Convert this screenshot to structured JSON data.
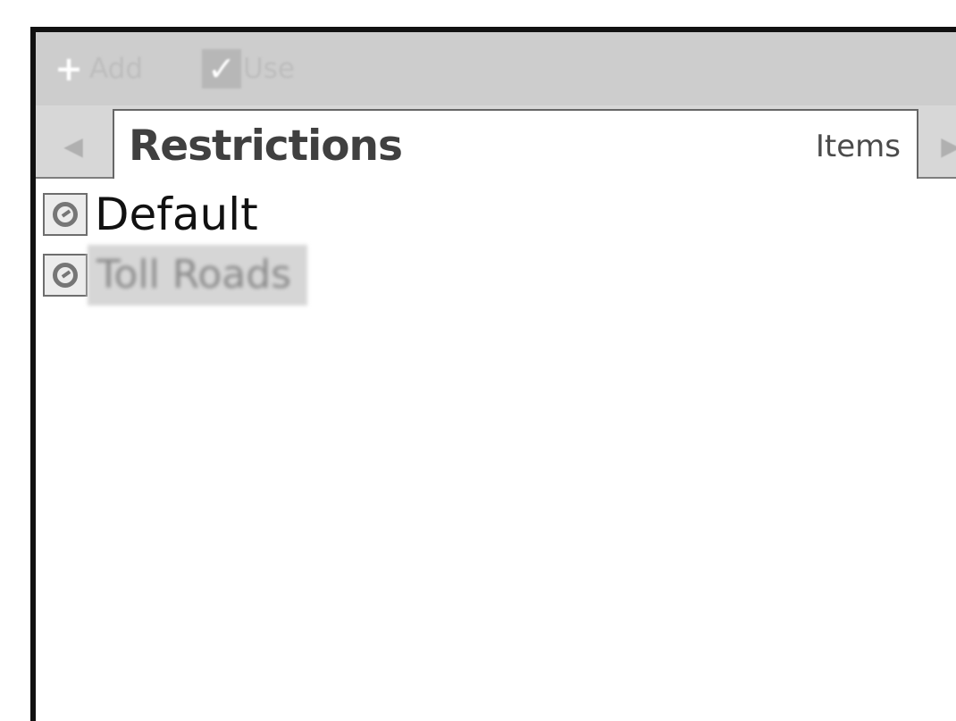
{
  "toolbar": {
    "add_icon": "+",
    "add_label": "Add",
    "use_icon": "✓",
    "use_label": "Use"
  },
  "tabs": {
    "left_arrow": "◀",
    "right_arrow": "▶",
    "active": {
      "title": "Restrictions",
      "subtitle": "Items"
    }
  },
  "list": {
    "items": [
      {
        "label": "Default",
        "icon": "restriction-icon"
      },
      {
        "label": "Toll Roads",
        "icon": "restriction-icon"
      }
    ]
  },
  "colors": {
    "toolbar": "#cdcdcd",
    "tab_background": "#d7d7d7",
    "selected_item": "#d6d6d6",
    "frame_border": "#111111"
  }
}
